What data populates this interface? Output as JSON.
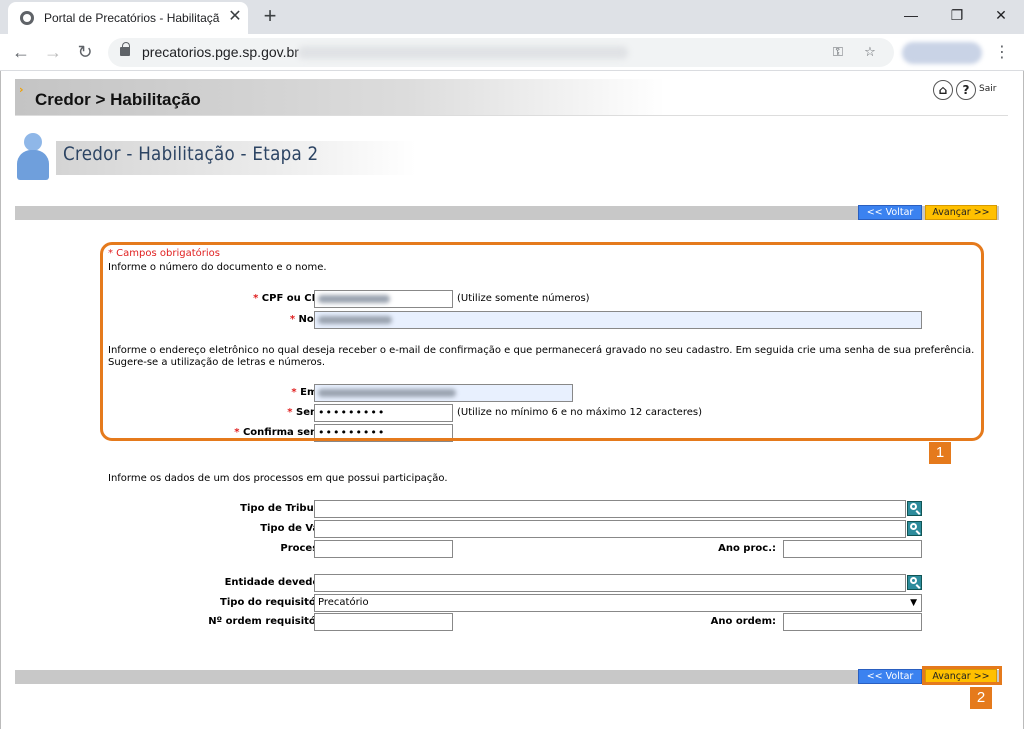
{
  "browser": {
    "tab_title": "Portal de Precatórios - Habilitaçã",
    "url": "precatorios.pge.sp.gov.br"
  },
  "header": {
    "breadcrumb": "Credor > Habilitação",
    "sair_label": "Sair",
    "help_label": "?"
  },
  "page": {
    "step_title": "Credor - Habilitação - Etapa 2",
    "buttons": {
      "voltar": "<< Voltar",
      "avancar": "Avançar >>"
    }
  },
  "section1": {
    "required_note": "* Campos obrigatórios",
    "intro": "Informe o número do documento e o nome.",
    "cpf_label": "CPF ou CNPJ:",
    "cpf_hint": "(Utilize somente números)",
    "nome_label": "Nome:",
    "email_intro": "Informe o endereço eletrônico no qual deseja receber o e-mail de confirmação e que permanecerá gravado no seu cadastro. Em seguida crie uma senha de sua preferência. Sugere-se a utilização de letras e números.",
    "email_label": "Email:",
    "senha_label": "Senha:",
    "senha_value": "•••••••••",
    "senha_hint": "(Utilize no mínimo 6 e no máximo 12 caracteres)",
    "confirma_label": "Confirma senha:",
    "confirma_value": "•••••••••",
    "required_mark": "*"
  },
  "section2": {
    "intro": "Informe os dados de um dos processos em que possui participação.",
    "tipo_tribunal_label": "Tipo de Tribunal:",
    "tipo_vara_label": "Tipo de Vara:",
    "processo_label": "Processo:",
    "ano_proc_label": "Ano proc.:",
    "entidade_label": "Entidade devedora:",
    "tipo_req_label": "Tipo do requisitório:",
    "tipo_req_value": "Precatório",
    "ordem_label": "Nº ordem requisitório:",
    "ano_ordem_label": "Ano ordem:"
  },
  "annotations": {
    "badge1": "1",
    "badge2": "2"
  },
  "colors": {
    "annotation": "#e57a1c",
    "voltar": "#3b82f0",
    "avancar": "#ffc000"
  }
}
